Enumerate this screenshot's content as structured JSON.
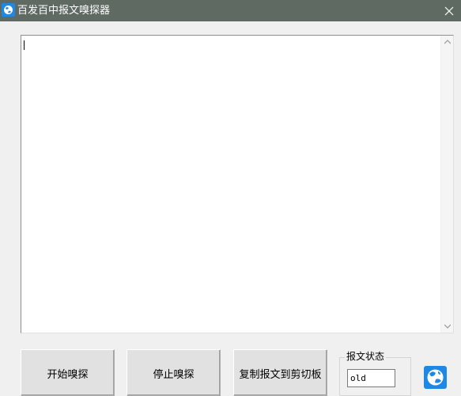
{
  "window": {
    "title": "百发百中报文嗅探器",
    "close_symbol": "✕"
  },
  "editor": {
    "content": ""
  },
  "buttons": {
    "start": "开始嗅探",
    "stop": "停止嗅探",
    "copy": "复制报文到剪切板"
  },
  "status_group": {
    "label": "报文状态",
    "value": "old"
  },
  "colors": {
    "titlebar": "#5f6a63",
    "window_bg": "#f0f0f0",
    "icon_blue": "#1e88e5"
  },
  "icons": {
    "app": "app-icon",
    "close": "close-icon",
    "corner": "app-globe-icon"
  }
}
